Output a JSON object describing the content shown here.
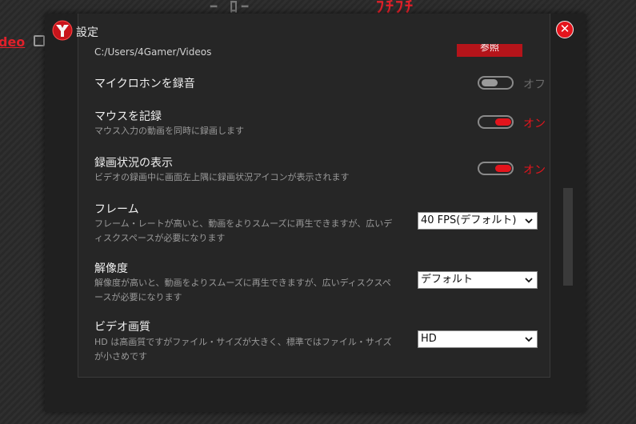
{
  "background": {
    "red_text": "ﾌﾁﾌﾁ",
    "gray_text": "ｰ ﾛｰ",
    "left_text": "deo"
  },
  "dialog": {
    "title": "設定",
    "close_icon": "close-icon",
    "logo_icon": "app-logo"
  },
  "save_path": {
    "value": "C:/Users/4Gamer/Videos",
    "browse_label": "参照"
  },
  "settings": {
    "microphone": {
      "title": "マイクロホンを録音",
      "state": "オフ",
      "on": false
    },
    "mouse": {
      "title": "マウスを記録",
      "desc": "マウス入力の動画を同時に録画します",
      "state": "オン",
      "on": true
    },
    "status": {
      "title": "録画状況の表示",
      "desc": "ビデオの録画中に画面左上隅に録画状況アイコンが表示されます",
      "state": "オン",
      "on": true
    },
    "frame": {
      "title": "フレーム",
      "desc": "フレーム・レートが高いと、動画をよりスムーズに再生できますが、広いディスクスペースが必要になります",
      "selected": "40 FPS(デフォルト)"
    },
    "resolution": {
      "title": "解像度",
      "desc": "解像度が高いと、動画をよりスムーズに再生できますが、広いディスクスペースが必要になります",
      "selected": "デフォルト"
    },
    "quality": {
      "title": "ビデオ画質",
      "desc": "HD は高画質ですがファイル・サイズが大きく、標準ではファイル・サイズが小さめです",
      "selected": "HD"
    }
  },
  "colors": {
    "accent": "#e4141c",
    "dialog_bg": "#202020",
    "panel_bg": "#262626"
  }
}
